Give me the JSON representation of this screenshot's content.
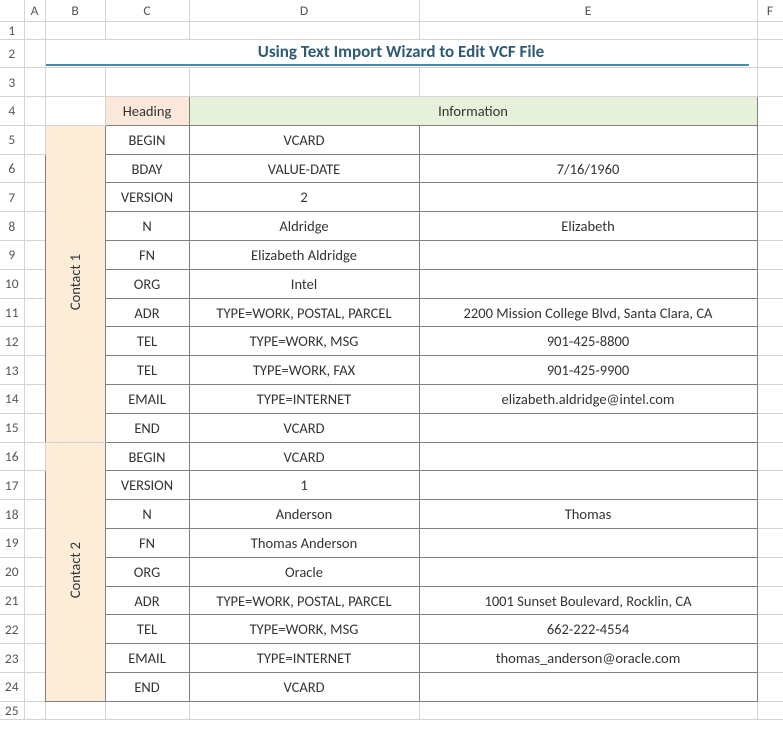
{
  "cols": [
    "",
    "A",
    "B",
    "C",
    "D",
    "E",
    "F"
  ],
  "rows": [
    "1",
    "2",
    "3",
    "4",
    "5",
    "6",
    "7",
    "8",
    "9",
    "10",
    "11",
    "12",
    "13",
    "14",
    "15",
    "16",
    "17",
    "18",
    "19",
    "20",
    "21",
    "22",
    "23",
    "24",
    "25"
  ],
  "title": "Using Text Import Wizard to Edit VCF File",
  "headers": {
    "heading": "Heading",
    "information": "Information"
  },
  "sides": {
    "c1": "Contact 1",
    "c2": "Contact 2"
  },
  "contact1": [
    {
      "h": "BEGIN",
      "d": "VCARD",
      "e": ""
    },
    {
      "h": "BDAY",
      "d": "VALUE-DATE",
      "e": "7/16/1960"
    },
    {
      "h": "VERSION",
      "d": "2",
      "e": ""
    },
    {
      "h": "N",
      "d": "Aldridge",
      "e": "Elizabeth"
    },
    {
      "h": "FN",
      "d": "Elizabeth Aldridge",
      "e": ""
    },
    {
      "h": "ORG",
      "d": "Intel",
      "e": ""
    },
    {
      "h": "ADR",
      "d": "TYPE=WORK, POSTAL, PARCEL",
      "e": "2200 Mission College Blvd, Santa Clara, CA"
    },
    {
      "h": "TEL",
      "d": "TYPE=WORK, MSG",
      "e": "901-425-8800"
    },
    {
      "h": "TEL",
      "d": "TYPE=WORK, FAX",
      "e": "901-425-9900"
    },
    {
      "h": "EMAIL",
      "d": "TYPE=INTERNET",
      "e": "elizabeth.aldridge@intel.com"
    },
    {
      "h": "END",
      "d": "VCARD",
      "e": ""
    }
  ],
  "contact2": [
    {
      "h": "BEGIN",
      "d": "VCARD",
      "e": ""
    },
    {
      "h": "VERSION",
      "d": "1",
      "e": ""
    },
    {
      "h": "N",
      "d": "Anderson",
      "e": "Thomas"
    },
    {
      "h": "FN",
      "d": "Thomas Anderson",
      "e": ""
    },
    {
      "h": "ORG",
      "d": "Oracle",
      "e": ""
    },
    {
      "h": "ADR",
      "d": "TYPE=WORK, POSTAL, PARCEL",
      "e": "1001 Sunset Boulevard, Rocklin, CA"
    },
    {
      "h": "TEL",
      "d": "TYPE=WORK, MSG",
      "e": "662-222-4554"
    },
    {
      "h": "EMAIL",
      "d": "TYPE=INTERNET",
      "e": "thomas_anderson@oracle.com"
    },
    {
      "h": "END",
      "d": "VCARD",
      "e": ""
    }
  ]
}
